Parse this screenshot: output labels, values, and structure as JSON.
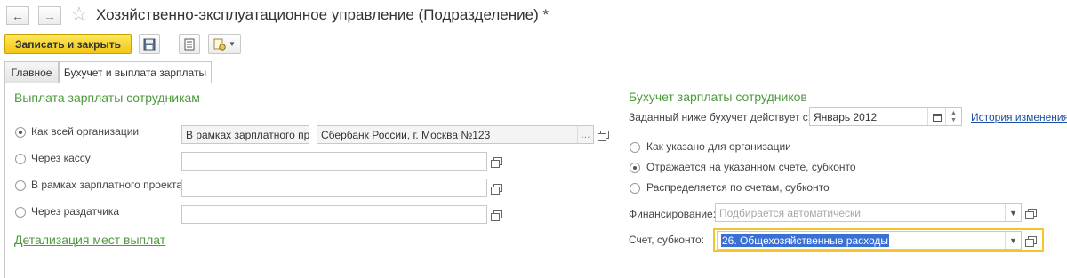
{
  "header": {
    "title": "Хозяйственно-эксплуатационное управление (Подразделение) *",
    "back_icon": "arrow-left",
    "forward_icon": "arrow-right",
    "favorite_icon": "star-outline"
  },
  "toolbar": {
    "save_close_label": "Записать и закрыть",
    "save_icon": "floppy-disk",
    "report_icon": "document-list",
    "more_icon": "document-settings"
  },
  "tabs": [
    {
      "label": "Главное"
    },
    {
      "label": "Бухучет и выплата зарплаты"
    }
  ],
  "payout": {
    "title": "Выплата зарплаты сотрудникам",
    "options": [
      {
        "label": "Как всей организации",
        "checked": true
      },
      {
        "label": "Через кассу",
        "checked": false
      },
      {
        "label": "В рамках зарплатного проекта",
        "checked": false
      },
      {
        "label": "Через раздатчика",
        "checked": false
      }
    ],
    "org_mode_value": "В рамках зарплатного про",
    "org_bank_value": "Сбербанк России, г. Москва №123",
    "details_link": "Детализация мест выплат"
  },
  "accounting": {
    "title": "Бухучет зарплаты сотрудников",
    "effective_label": "Заданный ниже бухучет действует с:",
    "effective_value": "Январь 2012",
    "history_link": "История изменения",
    "options": [
      {
        "label": "Как указано для организации",
        "checked": false
      },
      {
        "label": "Отражается на указанном счете, субконто",
        "checked": true
      },
      {
        "label": "Распределяется по счетам, субконто",
        "checked": false
      }
    ],
    "financing_label": "Финансирование:",
    "financing_placeholder": "Подбирается автоматически",
    "account_label": "Счет, субконто:",
    "account_value": "26. Общехозяйственные расходы"
  }
}
